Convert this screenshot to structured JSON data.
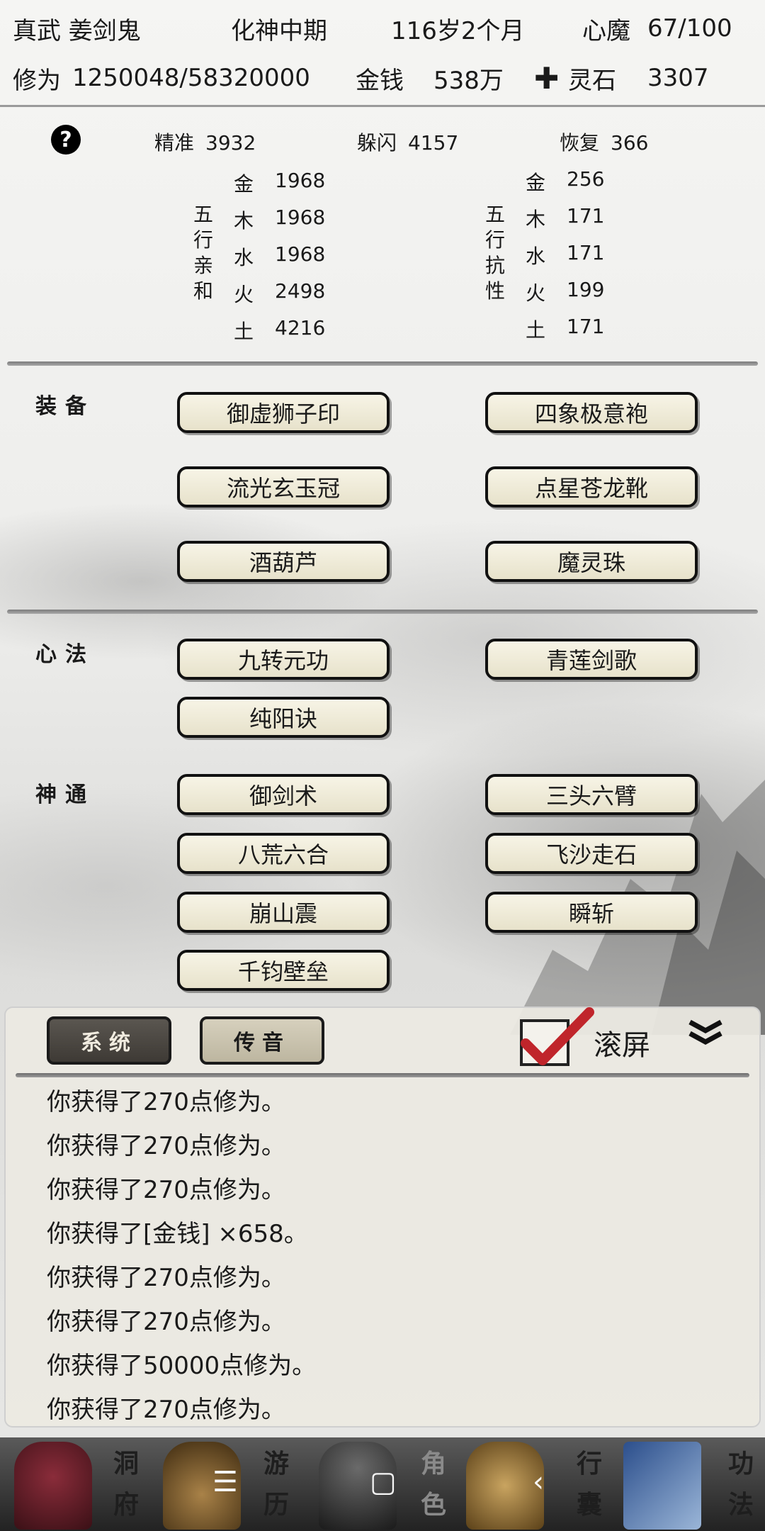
{
  "header": {
    "title": "真武 姜剑鬼",
    "realm": "化神中期",
    "age": "116岁2个月",
    "xinmo_label": "心魔",
    "xinmo_value": "67/100",
    "xiuwei_label": "修为",
    "xiuwei_value": "1250048/58320000",
    "money_label": "金钱",
    "money_value": "538万",
    "spirit_label": "灵石",
    "spirit_value": "3307"
  },
  "stats": {
    "accuracy_label": "精准",
    "accuracy_value": "3932",
    "dodge_label": "躲闪",
    "dodge_value": "4157",
    "recover_label": "恢复",
    "recover_value": "366",
    "affinity_title": "五行亲和",
    "affinity": [
      {
        "el": "金",
        "v": "1968"
      },
      {
        "el": "木",
        "v": "1968"
      },
      {
        "el": "水",
        "v": "1968"
      },
      {
        "el": "火",
        "v": "2498"
      },
      {
        "el": "土",
        "v": "4216"
      }
    ],
    "resist_title": "五行抗性",
    "resist": [
      {
        "el": "金",
        "v": "256"
      },
      {
        "el": "木",
        "v": "171"
      },
      {
        "el": "水",
        "v": "171"
      },
      {
        "el": "火",
        "v": "199"
      },
      {
        "el": "土",
        "v": "171"
      }
    ]
  },
  "equipment": {
    "label": "装备",
    "items": [
      "御虚狮子印",
      "四象极意袍",
      "流光玄玉冠",
      "点星苍龙靴",
      "酒葫芦",
      "魔灵珠"
    ]
  },
  "xinfa": {
    "label": "心法",
    "items": [
      "九转元功",
      "青莲剑歌",
      "纯阳诀"
    ]
  },
  "shentong": {
    "label": "神通",
    "items": [
      "御剑术",
      "三头六臂",
      "八荒六合",
      "飞沙走石",
      "崩山震",
      "瞬斩",
      "千钧壁垒"
    ]
  },
  "log_panel": {
    "tab_system": "系统",
    "tab_voice": "传音",
    "scroll_label": "滚屏",
    "lines": [
      "你获得了270点修为。",
      "你获得了270点修为。",
      "你获得了270点修为。",
      "你获得了[金钱] ×658。",
      "你获得了270点修为。",
      "你获得了270点修为。",
      "你获得了50000点修为。",
      "你获得了270点修为。"
    ]
  },
  "bottom_tabs": {
    "cave": "洞府",
    "travel": "游历",
    "role": "角色",
    "bag": "行囊",
    "skill": "功法"
  },
  "colors": {
    "accent_check": "#c0252b",
    "button_bg": "#efeadb",
    "system_tab_bg": "#4a4640"
  }
}
